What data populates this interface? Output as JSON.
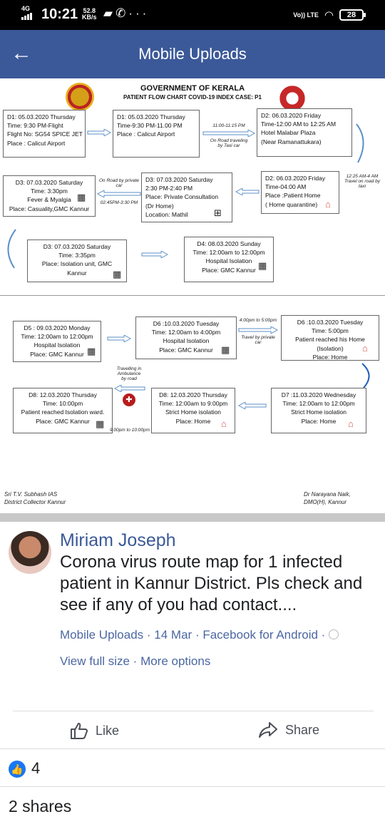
{
  "status_bar": {
    "network": "4G",
    "time": "10:21",
    "speed_value": "52.8",
    "speed_unit": "KB/s",
    "notif_icons": "gallery-icon whatsapp-icon more-icon",
    "volte": "Vo)) LTE",
    "battery": "28"
  },
  "app_bar": {
    "title": "Mobile Uploads",
    "back_icon": "arrow-back-icon"
  },
  "document": {
    "title": "GOVERNMENT OF KERALA",
    "subtitle": "PATIENT FLOW CHART COVID-19 INDEX CASE: P1",
    "boxes": {
      "b1": "D1: 05.03.2020 Thursday\nTime: 9:30 PM-Flight\nFlight No: SG54 SPICE JET\nPlace : Calicut Airport",
      "b2": "D1: 05.03.2020 Thursday\nTime-9:30 PM-11.00 PM\nPlace : Calicut Airport",
      "b3": "D2: 06.03.2020 Friday\nTime-12:00 AM to 12:25 AM\nHotel Malabar Plaza\n(Near Ramanattukara)",
      "b4": "D3: 07.03.2020 Saturday\nTime: 3:30pm\nFever & Myalgia\nPlace: Casuality,GMC Kannur",
      "b5": "D3: 07.03.2020 Saturday\n2:30 PM-2:40 PM\nPlace: Private Consultation\n(Dr Home)\nLocation: Mathil",
      "b6": "D2: 06.03.2020 Friday\nTime-04:00 AM\nPlace :Patient Home\n( Home quarantine)",
      "b7": "D3: 07.03.2020 Saturday\nTime: 3:35pm\nPlace: Isolation unit, GMC\nKannur",
      "b8": "D4: 08.03.2020 Sunday\nTime: 12:00am to 12:00pm\nHospital Isolation\nPlace: GMC Kannur",
      "b9": "D5 : 09.03.2020 Monday\nTime: 12:00am to 12:00pm\nHospital Isolation\nPlace: GMC Kannur",
      "b10": "D6 :10.03.2020 Tuesday\nTime: 12:00am to 4:00pm\nHospital Isolation\nPlace: GMC Kannur",
      "b11": "D6 :10.03.2020 Tuesday\nTime: 5:00pm\nPatient reached his Home\n(Isolation)\nPlace: Home",
      "b12": "D8: 12.03.2020 Thursday\nTime: 10:00pm\nPatient reached Isolation ward.\nPlace: GMC Kannur",
      "b13": "D8: 12.03.2020 Thursday\nTime: 12:00am to 9:00pm\nStrict Home isolation\nPlace: Home",
      "b14": "D7 :11.03.2020 Wednesday\nTime: 12:00am to 12:00pm\nStrict Home isolation\nPlace: Home"
    },
    "notes": {
      "n1": "11:00-11:15 PM",
      "n2": "On Road traveling\nby Taxi car",
      "n3": "12:25 AM-4 AM\nTravel on road by\ntaxi",
      "n4": "On Road by private\ncar",
      "n5": "02:45PM-3:30 PM",
      "n6": "4:00pm to 5:00pm",
      "n7": "Travel by private\ncar",
      "n8": "Travelling in\nAmbulance\nby road",
      "n9": "9:00pm to 10:00pm"
    },
    "signature_left": "Sri T.V. Subhash IAS\nDistrict Collector Kannur",
    "signature_right": "Dr Narayana Naik,\nDMO(H), Kannur"
  },
  "post": {
    "author": "Miriam Joseph",
    "text": "Corona virus route map for 1 infected patient in Kannur District. Pls check and see if any of you had contact....",
    "meta_album": "Mobile Uploads",
    "meta_date": "14 Mar",
    "meta_app": "Facebook for Android",
    "view_full_size": "View full size",
    "more_options": "More options"
  },
  "actions": {
    "like_label": "Like",
    "share_label": "Share"
  },
  "reactions": {
    "like_count": "4",
    "shares": "2 shares"
  }
}
